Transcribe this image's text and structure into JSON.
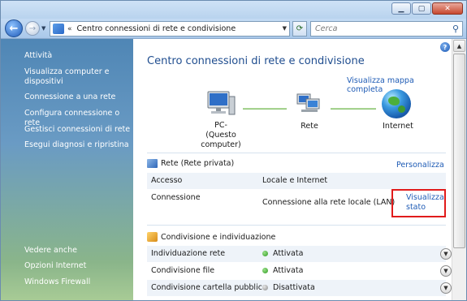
{
  "toolbar": {
    "address_path": "Centro connessioni di rete e condivisione",
    "address_chevron": "«",
    "search_placeholder": "Cerca"
  },
  "sidebar": {
    "tasks_header": "Attività",
    "tasks": [
      "Visualizza computer e dispositivi",
      "Connessione a una rete",
      "Configura connessione o rete",
      "Gestisci connessioni di rete",
      "Esegui diagnosi e ripristina"
    ],
    "see_also_header": "Vedere anche",
    "see_also": [
      "Opzioni Internet",
      "Windows Firewall"
    ]
  },
  "main": {
    "title": "Centro connessioni di rete e condivisione",
    "map_link": "Visualizza mappa completa",
    "map": {
      "pc_label_1": "PC-",
      "pc_label_2": "(Questo computer)",
      "network_label": "Rete",
      "internet_label": "Internet"
    },
    "network_section": {
      "title": "Rete (Rete privata)",
      "customize_link": "Personalizza",
      "rows": [
        {
          "key": "Accesso",
          "value": "Locale e Internet"
        },
        {
          "key": "Connessione",
          "value": "Connessione alla rete locale (LAN)"
        }
      ],
      "view_status_line1": "Visualizza",
      "view_status_line2": "stato"
    },
    "sharing_section": {
      "title": "Condivisione e individuazione",
      "rows": [
        {
          "key": "Individuazione rete",
          "value": "Attivata",
          "state": "on"
        },
        {
          "key": "Condivisione file",
          "value": "Attivata",
          "state": "on"
        },
        {
          "key": "Condivisione cartella pubblica",
          "value": "Disattivata",
          "state": "off"
        }
      ]
    }
  },
  "colors": {
    "link": "#1e5bb5",
    "title": "#1f4d8f",
    "highlight_box": "#e11b1b",
    "status_on": "#2f9a21",
    "status_off": "#8a8a8a"
  }
}
